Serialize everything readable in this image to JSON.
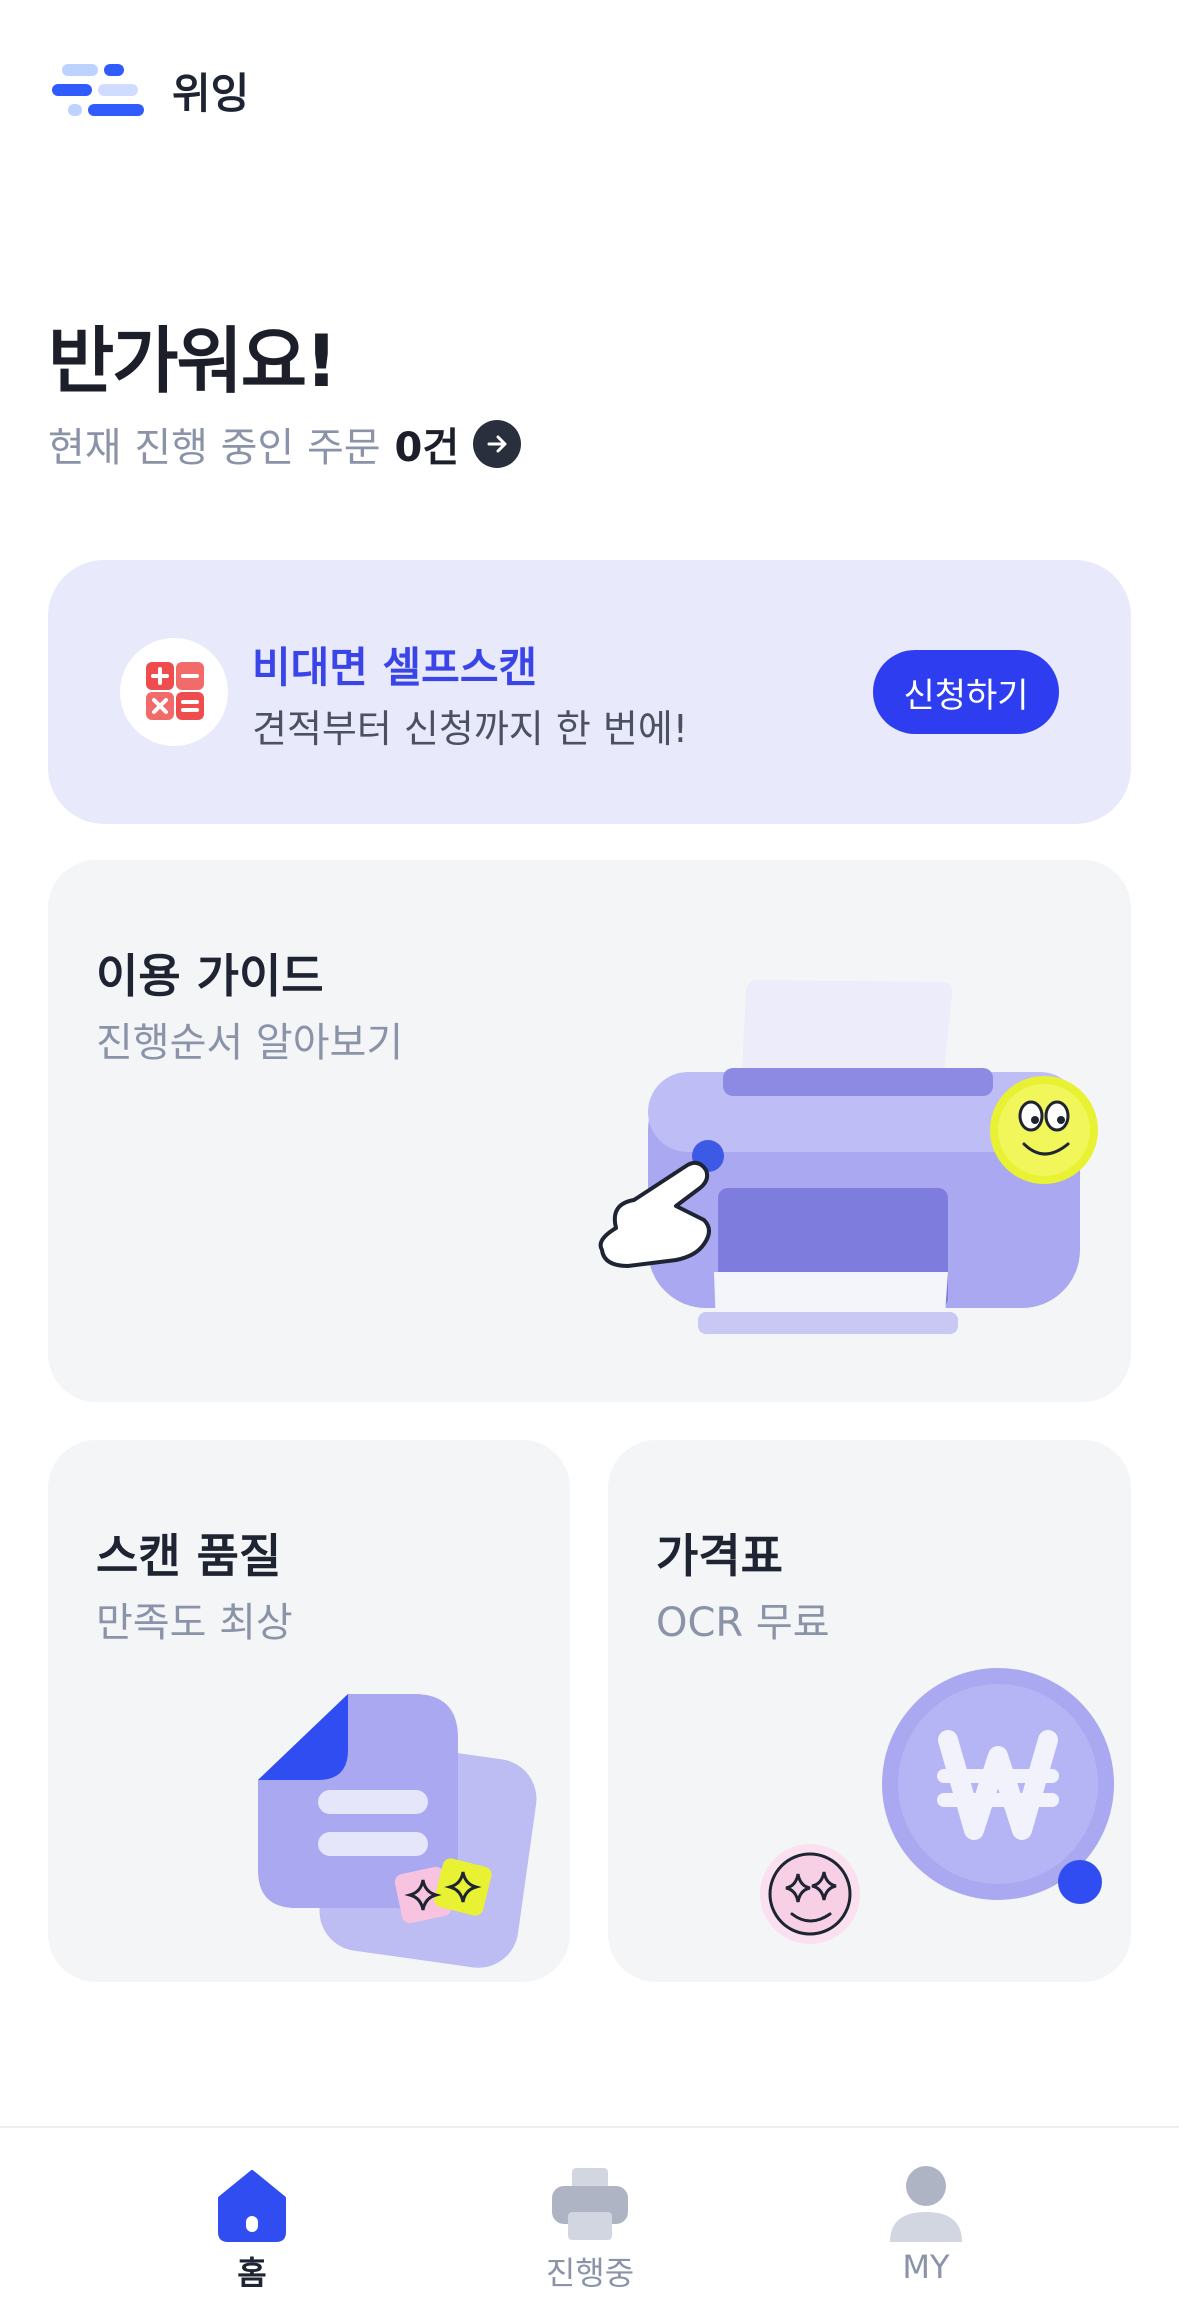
{
  "app": {
    "name": "위잉"
  },
  "greeting": "반가워요!",
  "orders": {
    "label": "현재 진행 중인 주문",
    "count": "0건"
  },
  "banner": {
    "title": "비대면 셀프스캔",
    "subtitle": "견적부터 신청까지 한 번에!",
    "button": "신청하기",
    "icon": "calculator-icon"
  },
  "cards": [
    {
      "title": "이용 가이드",
      "subtitle": "진행순서 알아보기",
      "icon": "printer-illustration"
    },
    {
      "title": "스캔 품질",
      "subtitle": "만족도 최상",
      "icon": "document-illustration"
    },
    {
      "title": "가격표",
      "subtitle": "OCR 무료",
      "icon": "won-coin-illustration"
    }
  ],
  "tabs": [
    {
      "label": "홈",
      "icon": "home-icon",
      "active": true
    },
    {
      "label": "진행중",
      "icon": "printer-icon",
      "active": false
    },
    {
      "label": "MY",
      "icon": "user-icon",
      "active": false
    }
  ],
  "colors": {
    "accent": "#2f3df0",
    "banner_bg": "#e8e9fb",
    "card_bg": "#f4f5f7",
    "muted_text": "#8a93a8"
  }
}
